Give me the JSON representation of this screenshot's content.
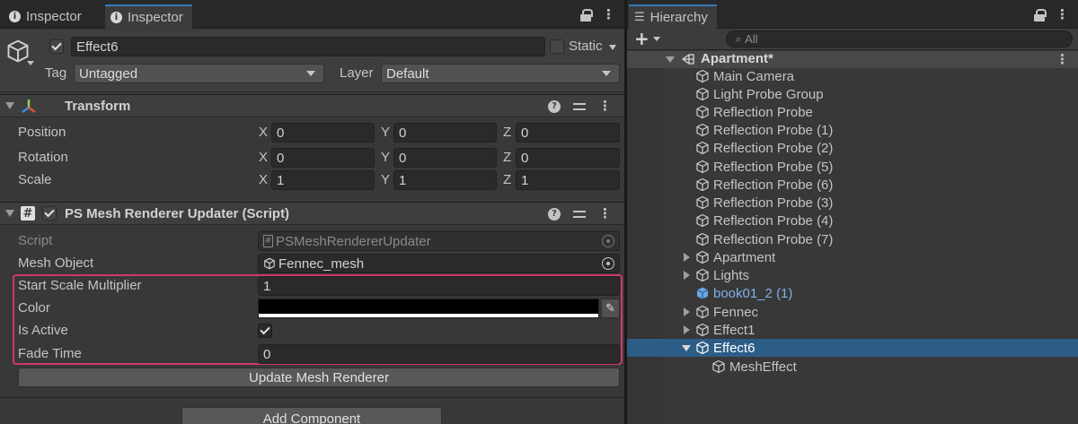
{
  "inspector": {
    "tabs": [
      {
        "label": "Inspector",
        "icon": "info-icon"
      },
      {
        "label": "Inspector",
        "icon": "info-icon"
      }
    ],
    "object": {
      "active": true,
      "name": "Effect6",
      "static_label": "Static",
      "static_checked": false,
      "tag_label": "Tag",
      "tag_value": "Untagged",
      "layer_label": "Layer",
      "layer_value": "Default"
    },
    "transform": {
      "title": "Transform",
      "rows": [
        {
          "label": "Position",
          "x": "0",
          "y": "0",
          "z": "0"
        },
        {
          "label": "Rotation",
          "x": "0",
          "y": "0",
          "z": "0"
        },
        {
          "label": "Scale",
          "x": "1",
          "y": "1",
          "z": "1"
        }
      ],
      "axis_labels": [
        "X",
        "Y",
        "Z"
      ]
    },
    "script_component": {
      "title": "PS Mesh Renderer Updater (Script)",
      "enabled": true,
      "script_label": "Script",
      "script_value": "PSMeshRendererUpdater",
      "mesh_object_label": "Mesh Object",
      "mesh_object_value": "Fennec_mesh",
      "start_scale_label": "Start Scale Multiplier",
      "start_scale_value": "1",
      "color_label": "Color",
      "color_value": "#000000",
      "is_active_label": "Is Active",
      "is_active_checked": true,
      "fade_time_label": "Fade Time",
      "fade_time_value": "0",
      "update_button": "Update Mesh Renderer"
    },
    "add_component_button": "Add Component"
  },
  "hierarchy": {
    "tab_label": "Hierarchy",
    "search_placeholder": "All",
    "scene_name": "Apartment*",
    "items": [
      {
        "label": "Main Camera"
      },
      {
        "label": "Light Probe Group"
      },
      {
        "label": "Reflection Probe"
      },
      {
        "label": "Reflection Probe (1)"
      },
      {
        "label": "Reflection Probe (2)"
      },
      {
        "label": "Reflection Probe (5)"
      },
      {
        "label": "Reflection Probe (6)"
      },
      {
        "label": "Reflection Probe (3)"
      },
      {
        "label": "Reflection Probe (4)"
      },
      {
        "label": "Reflection Probe (7)"
      },
      {
        "label": "Apartment"
      },
      {
        "label": "Lights"
      },
      {
        "label": "book01_2 (1)"
      },
      {
        "label": "Fennec"
      },
      {
        "label": "Effect1"
      },
      {
        "label": "Effect6"
      },
      {
        "label": "MeshEffect"
      }
    ]
  },
  "colors": {
    "selection": "#2c5d87",
    "highlight_border": "#d0376a",
    "prefab_text": "#7fb2e6",
    "tab_accent": "#3a79bb"
  }
}
